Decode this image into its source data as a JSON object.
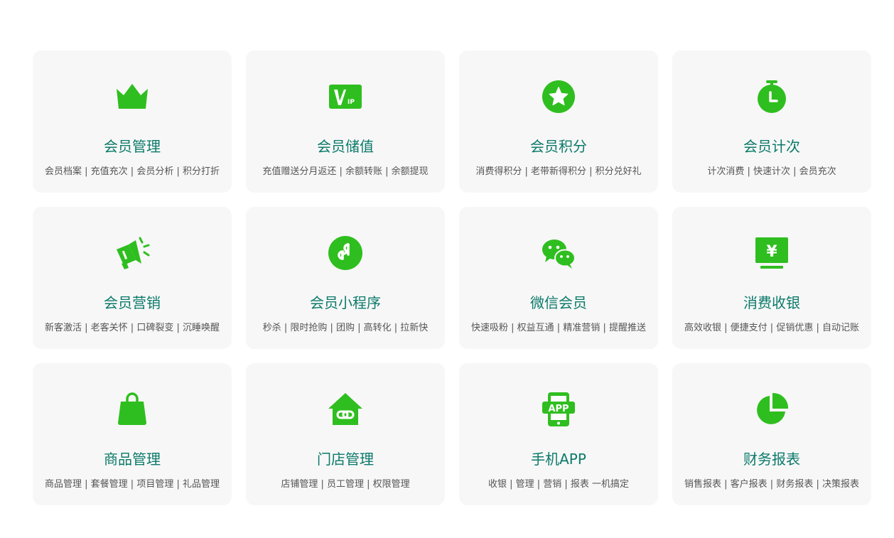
{
  "colors": {
    "accent": "#2fbe1f",
    "title": "#0b7a6a",
    "card_bg": "#f7f7f7",
    "desc": "#555555"
  },
  "cards": [
    {
      "icon": "crown-icon",
      "title": "会员管理",
      "desc": "会员档案 | 充值充次 | 会员分析 | 积分打折"
    },
    {
      "icon": "vip-card-icon",
      "title": "会员储值",
      "desc": "充值赠送分月返还 | 余额转账 | 余额提现",
      "icon_text": "IP"
    },
    {
      "icon": "star-badge-icon",
      "title": "会员积分",
      "desc": "消费得积分 | 老带新得积分 | 积分兑好礼"
    },
    {
      "icon": "stopwatch-icon",
      "title": "会员计次",
      "desc": "计次消费 | 快速计次 | 会员充次"
    },
    {
      "icon": "megaphone-icon",
      "title": "会员营销",
      "desc": "新客激活 | 老客关怀 | 口碑裂变 | 沉睡唤醒"
    },
    {
      "icon": "mini-program-icon",
      "title": "会员小程序",
      "desc": "秒杀 | 限时抢购 | 团购 | 高转化 | 拉新快"
    },
    {
      "icon": "wechat-icon",
      "title": "微信会员",
      "desc": "快速吸粉 | 权益互通 | 精准营销 | 提醒推送"
    },
    {
      "icon": "cashier-icon",
      "title": "消费收银",
      "desc": "高效收银 | 便捷支付 | 促销优惠 | 自动记账",
      "icon_text": "¥"
    },
    {
      "icon": "shopping-bag-icon",
      "title": "商品管理",
      "desc": "商品管理 | 套餐管理 | 项目管理 | 礼品管理"
    },
    {
      "icon": "store-link-icon",
      "title": "门店管理",
      "desc": "店铺管理 | 员工管理 | 权限管理"
    },
    {
      "icon": "mobile-app-icon",
      "title": "手机APP",
      "desc": "收银 | 管理 | 营销 | 报表 一机搞定",
      "icon_text": "APP"
    },
    {
      "icon": "pie-chart-icon",
      "title": "财务报表",
      "desc": "销售报表 | 客户报表 | 财务报表 | 决策报表"
    }
  ]
}
